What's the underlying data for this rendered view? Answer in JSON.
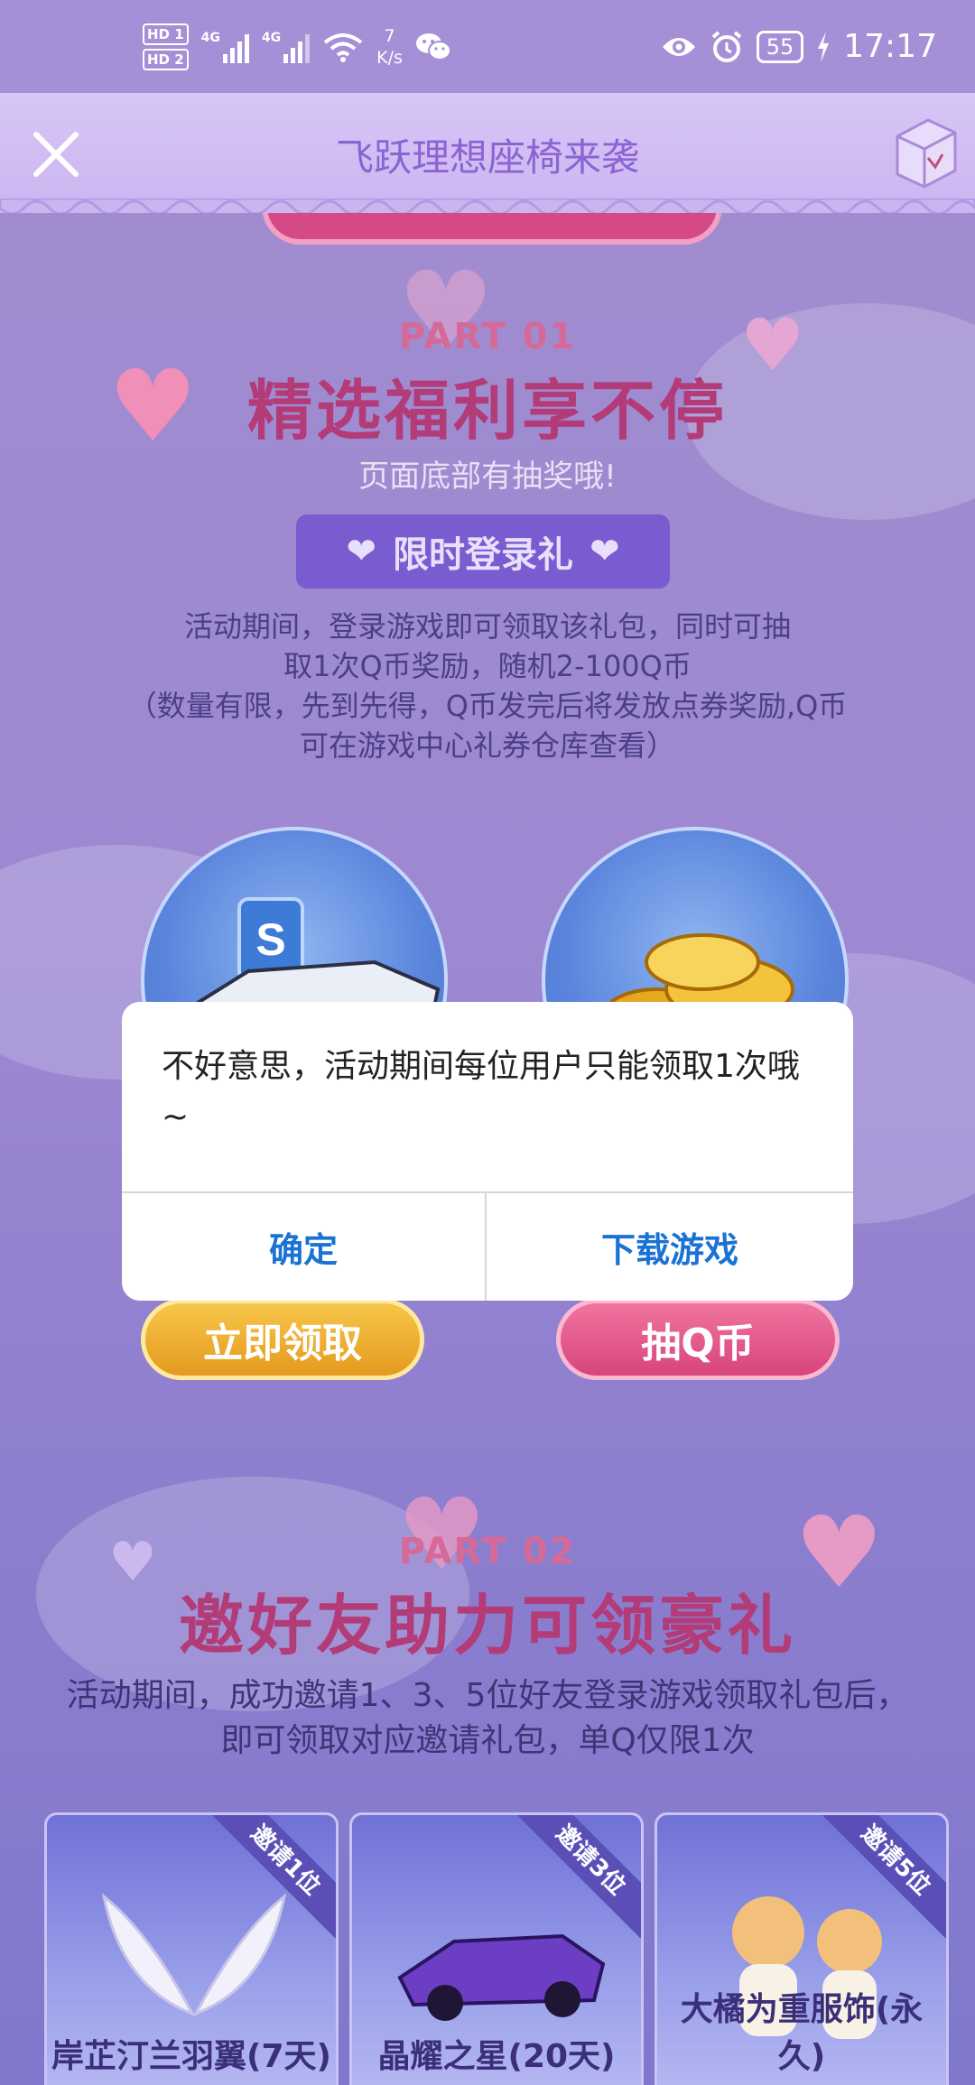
{
  "status_bar": {
    "sim1": "HD 1",
    "sim2": "HD 2",
    "net1": "4G",
    "net2": "4G",
    "speed_value": "7",
    "speed_unit": "K/s",
    "battery": "55",
    "time": "17:17"
  },
  "header": {
    "title": "飞跃理想座椅来袭"
  },
  "part1": {
    "label": "PART 01",
    "title": "精选福利享不停",
    "subtitle": "页面底部有抽奖哦!",
    "pill_label": "限时登录礼",
    "desc_line1": "活动期间，登录游戏即可领取该礼包，同时可抽",
    "desc_line2": "取1次Q币奖励，随机2-100Q币",
    "desc_line3": "（数量有限，先到先得，Q币发完后将发放点券奖励,Q币",
    "desc_line4": "可在游戏中心礼券仓库查看）",
    "claim_button": "立即领取",
    "draw_button": "抽Q币"
  },
  "part2": {
    "label": "PART 02",
    "title": "邀好友助力可领豪礼",
    "desc_line1": "活动期间，成功邀请1、3、5位好友登录游戏领取礼包后，",
    "desc_line2": "即可领取对应邀请礼包，单Q仅限1次",
    "cards": [
      {
        "ribbon": "邀请1位",
        "label": "岸芷汀兰羽翼(7天)"
      },
      {
        "ribbon": "邀请3位",
        "label": "晶耀之星(20天)"
      },
      {
        "ribbon": "邀请5位",
        "label": "大橘为重服饰(永久)"
      }
    ]
  },
  "dialog": {
    "message": "不好意思，活动期间每位用户只能领取1次哦~",
    "confirm_label": "确定",
    "download_label": "下载游戏"
  }
}
